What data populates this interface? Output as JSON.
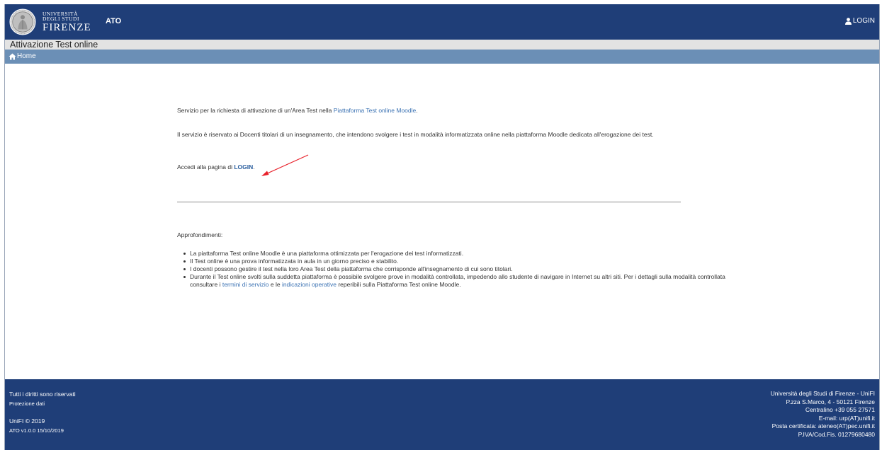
{
  "header": {
    "logo": {
      "line1": "UNIVERSITÀ",
      "line2": "DEGLI STUDI",
      "line3": "FIRENZE"
    },
    "app_name": "ATO",
    "login_label": "LOGIN"
  },
  "title_bar": {
    "title": "Attivazione Test online"
  },
  "breadcrumb": {
    "home_label": "Home"
  },
  "content": {
    "para1_text": "Servizio per la richiesta di attivazione di un'Area Test nella ",
    "para1_link": "Piattaforma Test online Moodle",
    "para1_end": ".",
    "para2": "Il servizio è riservato ai Docenti titolari di un insegnamento, che intendono svolgere i test in modalità informatizzata online nella piattaforma Moodle dedicata all'erogazione dei test.",
    "para3_text": "Accedi alla pagina di ",
    "para3_link": "LOGIN",
    "para3_end": ".",
    "approfondimenti_label": "Approfondimenti:",
    "bullet1": "La piattaforma Test online Moodle è una piattaforma ottimizzata per l'erogazione dei test informatizzati.",
    "bullet2": "Il Test online è una prova informatizzata in aula in un giorno preciso e stabilito.",
    "bullet3": "I docenti possono gestire il test nella loro Area Test della piattaforma che corrisponde all'insegnamento di cui sono titolari.",
    "bullet4_a": "Durante il Test online svolti sulla suddetta piattaforma è possibile svolgere prove in modalità controllata, impedendo allo studente di navigare in Internet su altri siti. Per i dettagli sulla modalità controllata consultare i ",
    "bullet4_link1": "termini di servizio",
    "bullet4_b": " e le ",
    "bullet4_link2": "indicazioni operative",
    "bullet4_c": " reperibili sulla Piattaforma Test online Moodle."
  },
  "footer": {
    "rights": "Tutti i diritti sono riservati",
    "privacy": "Protezione dati",
    "copyright": "UniFI © 2019",
    "version": "ATO v1.0.0 15/10/2019",
    "university": "Università  degli Studi di Firenze - UniFI",
    "address": "P.zza S.Marco, 4 - 50121 Firenze",
    "phone": "Centralino +39 055 27571",
    "email": "E-mail: urp(AT)unifi.it",
    "pec": "Posta certificata: ateneo(AT)pec.unifi.it",
    "vat": "P.IVA/Cod.Fis. 01279680480"
  },
  "colors": {
    "header_bg": "#1f3e78",
    "breadcrumb_bg": "#6b8fb6",
    "link": "#3b72b3",
    "annotation_arrow": "#e8202a"
  },
  "icons": {
    "user": "user-icon",
    "home": "home-icon",
    "seal": "university-seal"
  }
}
